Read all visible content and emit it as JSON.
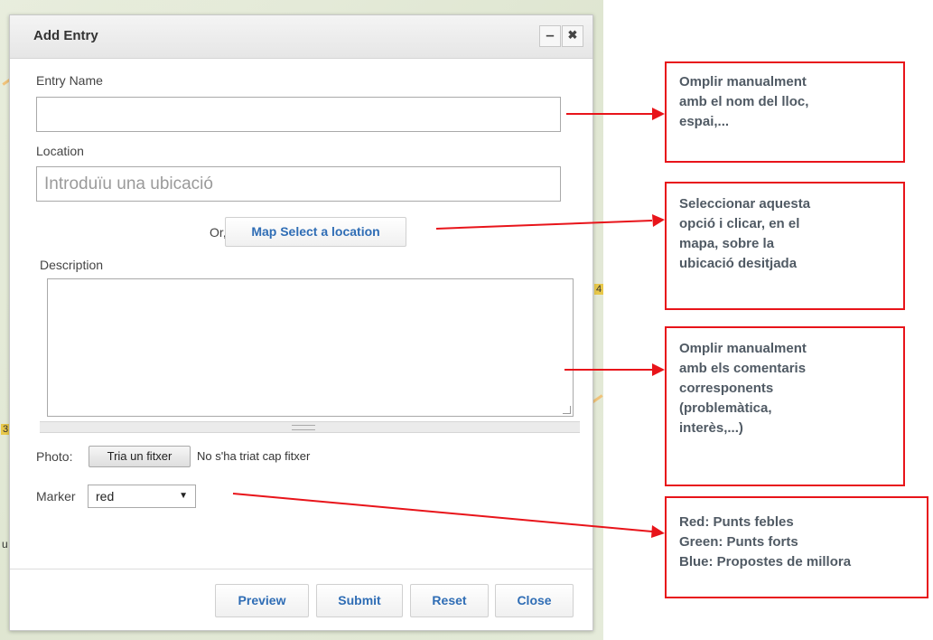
{
  "dialog": {
    "title": "Add Entry",
    "minimize_icon": "–",
    "close_icon": "✖",
    "entry_name_label": "Entry Name",
    "entry_name_value": "",
    "location_label": "Location",
    "location_placeholder": "Introduïu una ubicació",
    "or_label": "Or,",
    "map_select_button": "Map Select a location",
    "description_label": "Description",
    "description_value": "",
    "photo_label": "Photo:",
    "file_button": "Tria un fitxer",
    "file_status": "No s'ha triat cap fitxer",
    "marker_label": "Marker",
    "marker_value": "red",
    "buttons": {
      "preview": "Preview",
      "submit": "Submit",
      "reset": "Reset",
      "close": "Close"
    }
  },
  "callouts": {
    "entry_name": [
      "Omplir manualment",
      "amb el nom del lloc,",
      "espai,..."
    ],
    "location": [
      "Seleccionar aquesta",
      "opció i clicar, en el",
      "mapa, sobre la",
      "ubicació desitjada"
    ],
    "description": [
      "Omplir manualment",
      "amb els comentaris",
      "corresponents",
      "(problemàtica,",
      "interès,...)"
    ],
    "marker": [
      "Red:  Punts febles",
      "Green: Punts forts",
      "Blue: Propostes de millora"
    ]
  },
  "colors": {
    "callout_border": "#e8141a",
    "arrow": "#e8141a",
    "button_text": "#2f6db5"
  }
}
